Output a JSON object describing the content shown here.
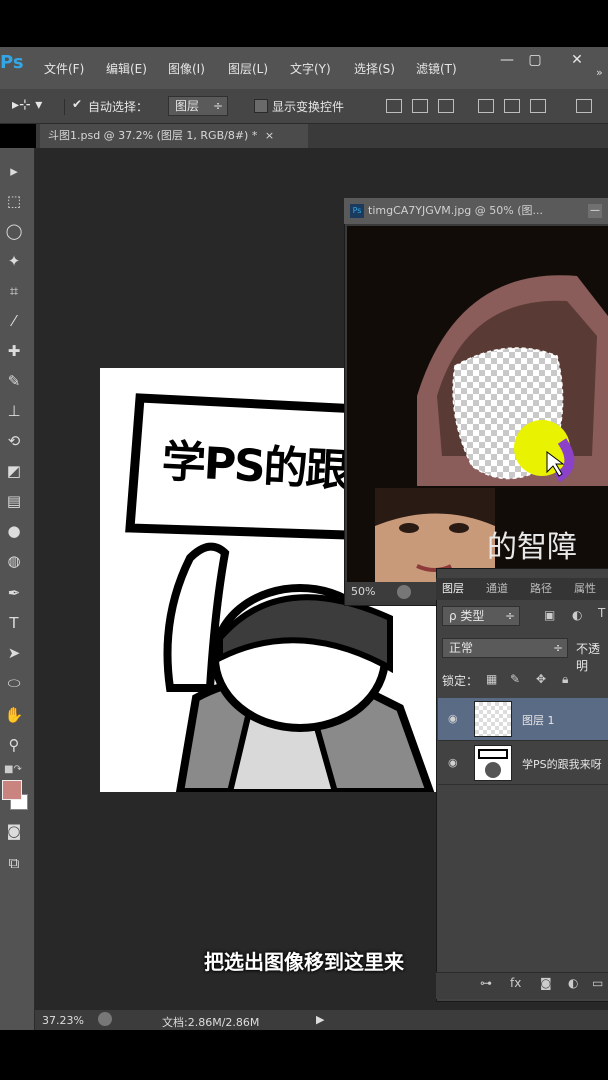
{
  "app": {
    "logo": "Ps"
  },
  "menubar": {
    "items": [
      "文件(F)",
      "编辑(E)",
      "图像(I)",
      "图层(L)",
      "文字(Y)",
      "选择(S)",
      "滤镜(T)"
    ],
    "window_buttons": [
      "—",
      "▢",
      "✕"
    ]
  },
  "options_bar": {
    "auto_select_label": "自动选择：",
    "auto_select_value": "图层",
    "show_transform_label": "显示变换控件"
  },
  "document_tab": {
    "label": "斗图1.psd @ 37.2% (图层 1, RGB/8#) *",
    "close": "×"
  },
  "canvas": {
    "sign_text": "学PS的跟"
  },
  "floating_doc": {
    "title": "timgCA7YJGVM.jpg @ 50% (图...",
    "zoom": "50%",
    "subtitle_text": "的智障"
  },
  "layers_panel": {
    "tabs": [
      "图层",
      "通道",
      "路径",
      "属性"
    ],
    "filter_label": "ρ 类型",
    "blend_mode": "正常",
    "opacity_label": "不透明",
    "lock_label": "锁定：",
    "layers": [
      {
        "name": "图层 1",
        "selected": true
      },
      {
        "name": "学PS的跟我来呀",
        "selected": false
      }
    ]
  },
  "status": {
    "zoom": "37.23%",
    "doc_info": "文档:2.86M/2.86M"
  },
  "caption": "把选出图像移到这里来",
  "colors": {
    "foreground": "#c98480",
    "background": "#ffffff",
    "accent": "#34a6e5"
  }
}
